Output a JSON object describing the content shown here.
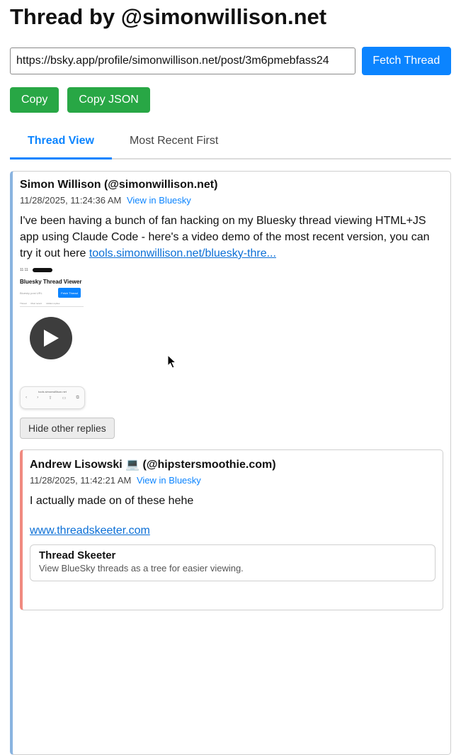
{
  "page": {
    "title": "Thread by @simonwillison.net"
  },
  "fetch": {
    "url_value": "https://bsky.app/profile/simonwillison.net/post/3m6pmebfass24",
    "button_label": "Fetch Thread"
  },
  "actions": {
    "copy_label": "Copy",
    "copy_json_label": "Copy JSON"
  },
  "tabs": [
    {
      "label": "Thread View",
      "active": true
    },
    {
      "label": "Most Recent First",
      "active": false
    }
  ],
  "post": {
    "author": "Simon Willison (@simonwillison.net)",
    "timestamp": "11/28/2025, 11:24:36 AM",
    "view_link": "View in Bluesky",
    "text_before_link": "I've been having a bunch of fan hacking on my Bluesky thread viewing HTML+JS app using Claude Code - here's a video demo of the most recent version, you can try it out here",
    "link_text": "tools.simonwillison.net/bluesky-thre...",
    "video_thumb": {
      "status_time": "11:11",
      "app_title": "Bluesky Thread Viewer",
      "input_placeholder": "Bluesky post URL",
      "fetch_btn": "Fetch Thread",
      "tab1": "Thread",
      "tab2": "Most recent",
      "tab3": "Hidden replies",
      "url_bar": "tools.simonwillison.net"
    },
    "hide_replies_label": "Hide other replies"
  },
  "reply": {
    "author": "Andrew Lisowski 💻 (@hipstersmoothie.com)",
    "timestamp": "11/28/2025, 11:42:21 AM",
    "view_link": "View in Bluesky",
    "text": "I actually made on of these hehe",
    "link_text": "www.threadskeeter.com",
    "card": {
      "title": "Thread Skeeter",
      "description": "View BlueSky threads as a tree for easier viewing."
    }
  },
  "colors": {
    "primary": "#0b84ff",
    "copy_green": "#28a745",
    "post_border": "#8ab4e0",
    "reply_border": "#f08a80"
  }
}
